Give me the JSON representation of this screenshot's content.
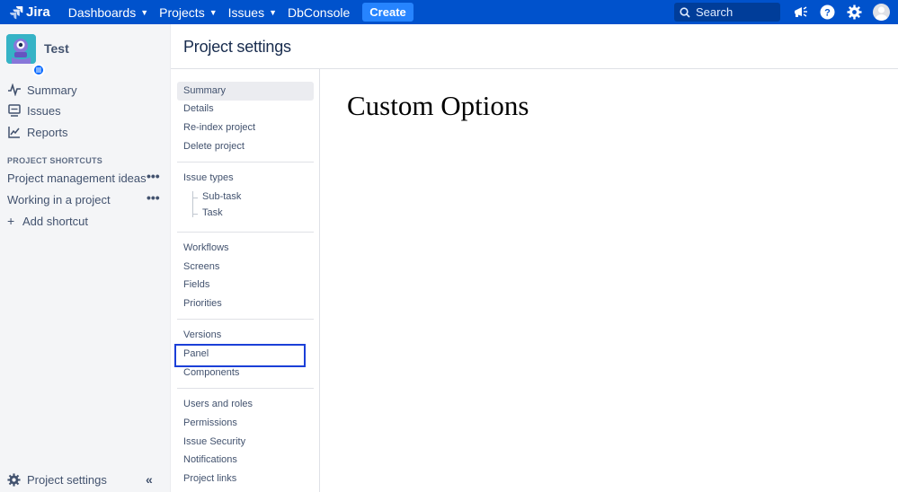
{
  "topnav": {
    "logo_text": "Jira",
    "items": [
      {
        "label": "Dashboards",
        "has_dropdown": true
      },
      {
        "label": "Projects",
        "has_dropdown": true
      },
      {
        "label": "Issues",
        "has_dropdown": true
      },
      {
        "label": "DbConsole",
        "has_dropdown": false
      }
    ],
    "create_label": "Create",
    "search_placeholder": "Search",
    "icons": [
      "megaphone-icon",
      "help-icon",
      "settings-icon",
      "user-avatar"
    ]
  },
  "sidebar": {
    "project_name": "Test",
    "items": [
      {
        "label": "Summary",
        "icon": "summary-icon"
      },
      {
        "label": "Issues",
        "icon": "issues-icon"
      },
      {
        "label": "Reports",
        "icon": "reports-icon"
      }
    ],
    "shortcuts_heading": "PROJECT SHORTCUTS",
    "shortcuts": [
      {
        "label": "Project management ideas"
      },
      {
        "label": "Working in a project"
      }
    ],
    "add_shortcut_label": "Add shortcut",
    "footer_label": "Project settings"
  },
  "page": {
    "title": "Project settings"
  },
  "settings_nav": {
    "group1": [
      "Summary",
      "Details",
      "Re-index project",
      "Delete project"
    ],
    "issue_types_label": "Issue types",
    "issue_types_children": [
      "Sub-task",
      "Task"
    ],
    "group3": [
      "Workflows",
      "Screens",
      "Fields",
      "Priorities"
    ],
    "group4": [
      "Versions",
      "Panel",
      "Components"
    ],
    "group5": [
      "Users and roles",
      "Permissions",
      "Issue Security",
      "Notifications",
      "Project links"
    ],
    "active": "Summary",
    "highlighted": "Panel"
  },
  "content": {
    "heading": "Custom Options"
  },
  "colors": {
    "topnav": "#0052cc",
    "create_button": "#2684ff",
    "highlight_border": "#1b3fd8"
  }
}
